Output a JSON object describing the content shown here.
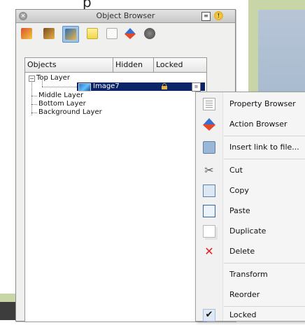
{
  "window": {
    "title": "Object Browser"
  },
  "background": {
    "top_text": "p"
  },
  "panel": {
    "columns": [
      "Objects",
      "Hidden",
      "Locked"
    ],
    "tree": [
      {
        "label": "Top Layer",
        "expander": "−"
      },
      {
        "label": "Image7",
        "selected": true,
        "locked": true
      },
      {
        "label": "Middle Layer"
      },
      {
        "label": "Bottom Layer"
      },
      {
        "label": "Background Layer"
      }
    ]
  },
  "context_menu": {
    "items": [
      {
        "label": "Property Browser",
        "icon": "property-browser-icon"
      },
      {
        "label": "Action Browser",
        "icon": "action-browser-icon"
      },
      {
        "label": "Insert link to file...",
        "icon": "link-file-icon"
      },
      {
        "label": "Cut",
        "icon": "scissors-icon"
      },
      {
        "label": "Copy",
        "icon": "copy-icon"
      },
      {
        "label": "Paste",
        "icon": "paste-icon"
      },
      {
        "label": "Duplicate",
        "icon": "duplicate-icon"
      },
      {
        "label": "Delete",
        "icon": "delete-x-icon"
      },
      {
        "label": "Transform"
      },
      {
        "label": "Reorder"
      },
      {
        "label": "Locked",
        "checked": true
      }
    ]
  },
  "colors": {
    "selection": "#0a246a",
    "delete": "#e02020",
    "tab_selected": "#9fc3e6"
  }
}
